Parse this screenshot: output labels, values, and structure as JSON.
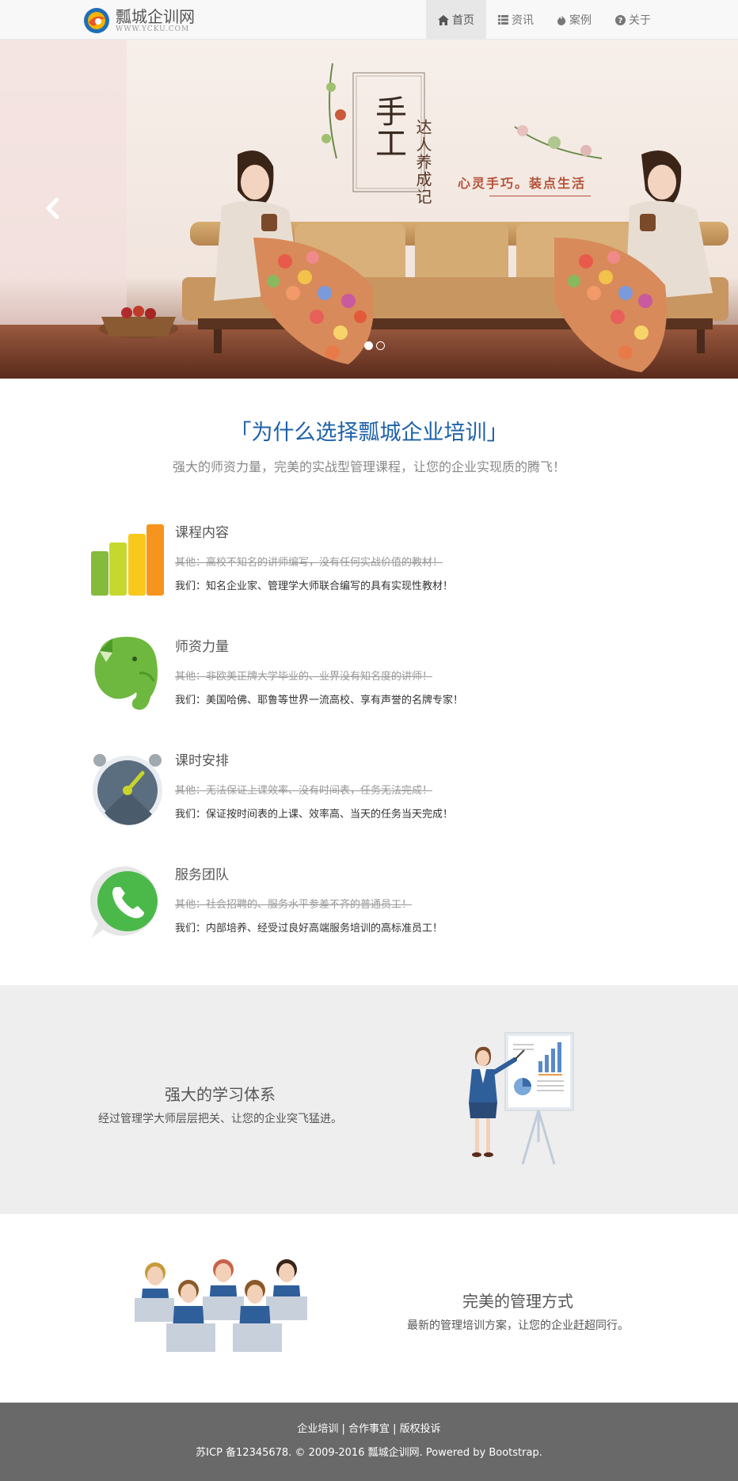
{
  "header": {
    "logo_title": "瓢城企训网",
    "logo_sub": "WWW.YCKU.COM",
    "nav": [
      {
        "label": "首页",
        "icon": "home-icon",
        "active": true
      },
      {
        "label": "资讯",
        "icon": "list-icon",
        "active": false
      },
      {
        "label": "案例",
        "icon": "fire-icon",
        "active": false
      },
      {
        "label": "关于",
        "icon": "question-icon",
        "active": false
      }
    ]
  },
  "banner": {
    "title_big": "手工",
    "title_side": "达人养成记",
    "slogan": "心灵手巧。装点生活",
    "slides": 2,
    "active_slide": 1
  },
  "why": {
    "title": "「为什么选择瓢城企业培训」",
    "subtitle": "强大的师资力量，完美的实战型管理课程，让您的企业实现质的腾飞！"
  },
  "features": [
    {
      "title": "课程内容",
      "other": "其他：高校不知名的讲师编写，没有任何实战价值的教材！",
      "ours": "我们：知名企业家、管理学大师联合编写的具有实现性教材！",
      "icon": "bar-chart-icon"
    },
    {
      "title": "师资力量",
      "other": "其他：非欧美正牌大学毕业的、业界没有知名度的讲师！",
      "ours": "我们：美国哈佛、耶鲁等世界一流高校、享有声誉的名牌专家！",
      "icon": "elephant-icon"
    },
    {
      "title": "课时安排",
      "other": "其他：无法保证上课效率、没有时间表，任务无法完成！",
      "ours": "我们：保证按时间表的上课、效率高、当天的任务当天完成！",
      "icon": "clock-icon"
    },
    {
      "title": "服务团队",
      "other": "其他：社会招聘的、服务水平参差不齐的普通员工！",
      "ours": "我们：内部培养、经受过良好高端服务培训的高标准员工！",
      "icon": "phone-icon"
    }
  ],
  "system": {
    "title": "强大的学习体系",
    "text": "经过管理学大师层层把关、让您的企业突飞猛进。"
  },
  "management": {
    "title": "完美的管理方式",
    "text": "最新的管理培训方案，让您的企业赶超同行。"
  },
  "footer": {
    "links": [
      "企业培训",
      "合作事宜",
      "版权投诉"
    ],
    "copyright": "苏ICP 备12345678. © 2009-2016 瓢城企训网. Powered by Bootstrap."
  }
}
